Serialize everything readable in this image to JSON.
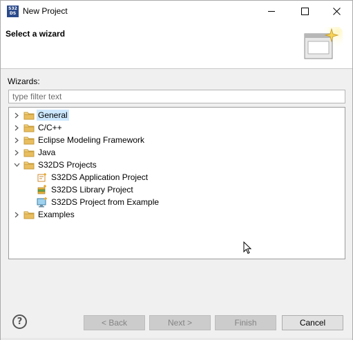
{
  "window": {
    "title": "New Project",
    "app_icon_text": "S32 DS"
  },
  "header": {
    "title": "Select a wizard"
  },
  "wizards": {
    "label": "Wizards:",
    "filter_placeholder": "type filter text",
    "filter_value": ""
  },
  "tree": {
    "items": [
      {
        "label": "General",
        "expanded": false,
        "selected": true,
        "icon": "folder-icon"
      },
      {
        "label": "C/C++",
        "expanded": false,
        "selected": false,
        "icon": "folder-icon"
      },
      {
        "label": "Eclipse Modeling Framework",
        "expanded": false,
        "selected": false,
        "icon": "folder-icon"
      },
      {
        "label": "Java",
        "expanded": false,
        "selected": false,
        "icon": "folder-icon"
      },
      {
        "label": "S32DS Projects",
        "expanded": true,
        "selected": false,
        "icon": "folder-icon",
        "children": [
          {
            "label": "S32DS Application Project",
            "icon": "application-project-icon"
          },
          {
            "label": "S32DS Library Project",
            "icon": "library-project-icon"
          },
          {
            "label": "S32DS Project from Example",
            "icon": "example-project-icon"
          }
        ]
      },
      {
        "label": "Examples",
        "expanded": false,
        "selected": false,
        "icon": "folder-icon"
      }
    ]
  },
  "footer": {
    "help_symbol": "?",
    "back_label": "< Back",
    "next_label": "Next >",
    "finish_label": "Finish",
    "cancel_label": "Cancel"
  },
  "colors": {
    "selection": "#cce8ff",
    "folder": "#dcb05a",
    "disabled_text": "#838383"
  }
}
